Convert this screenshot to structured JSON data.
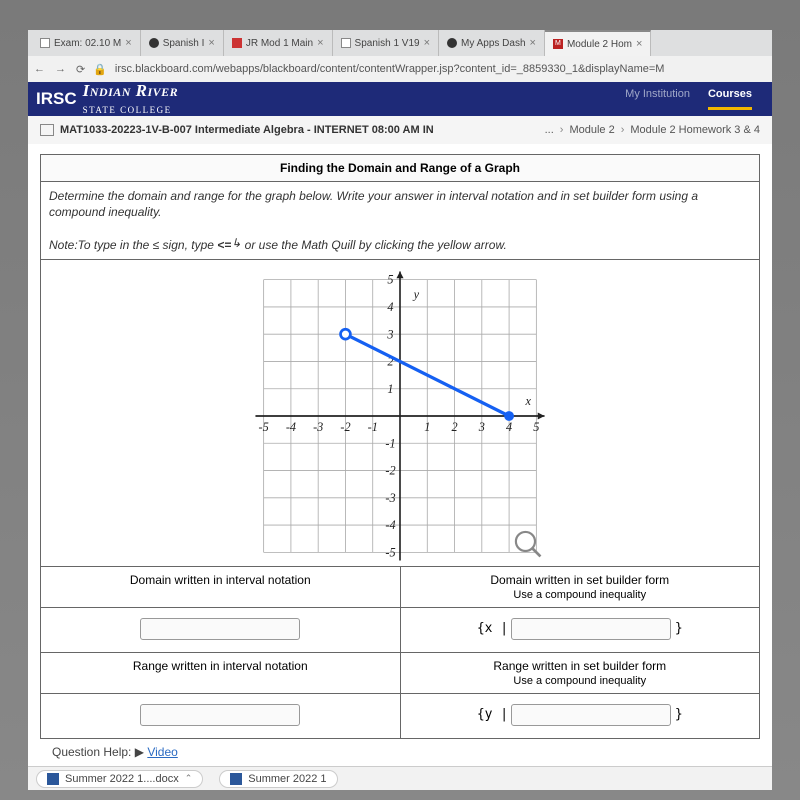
{
  "tabs": [
    {
      "label": "Exam: 02.10 M"
    },
    {
      "label": "Spanish I"
    },
    {
      "label": "JR Mod 1 Main"
    },
    {
      "label": "Spanish 1 V19"
    },
    {
      "label": "My Apps Dash"
    },
    {
      "label": "Module 2 Hom"
    }
  ],
  "url": "irsc.blackboard.com/webapps/blackboard/content/contentWrapper.jsp?content_id=_8859330_1&displayName=M",
  "institution": {
    "brand": "Indian River",
    "sub": "STATE COLLEGE",
    "logo_prefix": "IRSC"
  },
  "topnav": {
    "my_institution": "My Institution",
    "courses": "Courses"
  },
  "breadcrumb": {
    "course": "MAT1033-20223-1V-B-007 Intermediate Algebra - INTERNET 08:00 AM IN",
    "dots": "...",
    "mod": "Module 2",
    "hw": "Module 2 Homework 3 & 4"
  },
  "question": {
    "title": "Finding the Domain and Range of a Graph",
    "instr": "Determine the domain and range for the graph below. Write your answer in interval notation and in set builder form using a compound inequality.",
    "note_prefix": "Note:To type in the ",
    "note_sign": "≤",
    "note_mid": " sign, type ",
    "note_code": "<=",
    "note_suffix": " or use the Math Quill by clicking the yellow arrow.",
    "domain_interval_label": "Domain written in interval notation",
    "domain_set_label": "Domain written in set builder form",
    "domain_set_sub": "Use a compound inequality",
    "range_interval_label": "Range written in interval notation",
    "range_set_label": "Range written in set builder form",
    "range_set_sub": "Use a compound inequality",
    "set_open_x": "{x |",
    "set_open_y": "{y |",
    "set_close": "}"
  },
  "help": {
    "label": "Question Help:",
    "video": "Video"
  },
  "downloads": {
    "file1": "Summer 2022 1....docx",
    "file2": "Summer 2022 1"
  },
  "chart_data": {
    "type": "line",
    "title": "",
    "xlabel": "x",
    "ylabel": "y",
    "xlim": [
      -5,
      5
    ],
    "ylim": [
      -5,
      5
    ],
    "grid": true,
    "x_ticks": [
      -5,
      -4,
      -3,
      -2,
      -1,
      1,
      2,
      3,
      4,
      5
    ],
    "y_ticks": [
      -5,
      -4,
      -3,
      -2,
      -1,
      1,
      2,
      3,
      4,
      5
    ],
    "series": [
      {
        "name": "segment",
        "points": [
          {
            "x": -2,
            "y": 3,
            "endpoint": "open"
          },
          {
            "x": 4,
            "y": 0,
            "endpoint": "closed"
          }
        ]
      }
    ]
  }
}
